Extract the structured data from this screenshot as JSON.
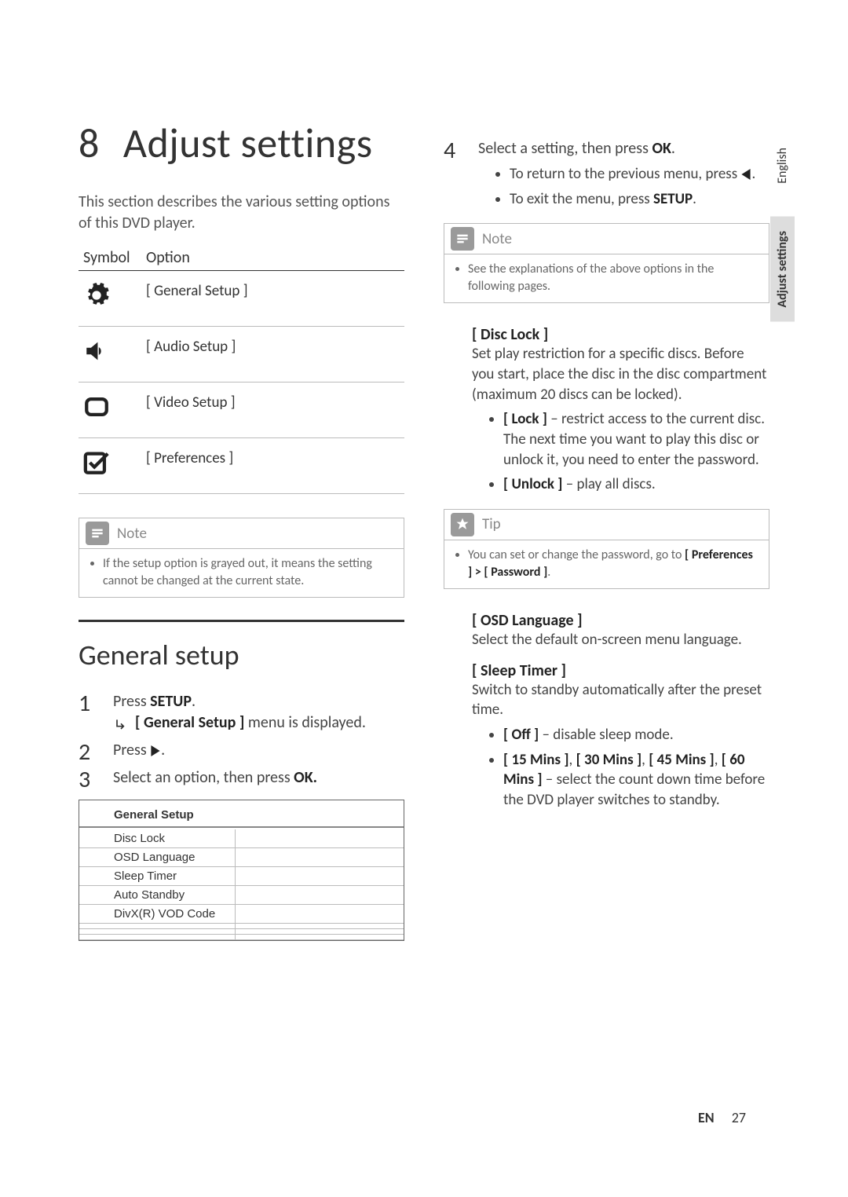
{
  "chapter": {
    "number": "8",
    "title": "Adjust settings"
  },
  "intro": "This section describes the various setting options of this DVD player.",
  "sym_table": {
    "head_sym": "Symbol",
    "head_opt": "Option",
    "rows": [
      {
        "icon": "gear-icon",
        "label": "[ General Setup ]"
      },
      {
        "icon": "speaker-icon",
        "label": "[ Audio Setup ]"
      },
      {
        "icon": "screen-icon",
        "label": "[ Video Setup ]"
      },
      {
        "icon": "check-icon",
        "label": "[ Preferences ]"
      }
    ]
  },
  "note1": {
    "title": "Note",
    "text": "If the setup option is grayed out, it means the setting cannot be changed at the current state."
  },
  "section": "General setup",
  "steps_left": {
    "s1_a": "Press ",
    "s1_b": "SETUP",
    "s1_c": ".",
    "s1_sub_a": "[ General Setup ]",
    "s1_sub_b": " menu is displayed.",
    "s2_a": "Press ",
    "s2_b": ".",
    "s3_a": "Select an option, then press ",
    "s3_b": "OK."
  },
  "menu": {
    "title": "General Setup",
    "items": [
      "Disc Lock",
      "OSD Language",
      "Sleep Timer",
      "Auto Standby",
      "DivX(R) VOD Code",
      "",
      "",
      ""
    ]
  },
  "steps_right": {
    "s4_a": "Select a setting, then press ",
    "s4_b": "OK",
    "s4_c": ".",
    "b1_a": "To return to the previous menu, press ",
    "b1_b": ".",
    "b2_a": "To exit the menu, press ",
    "b2_b": "SETUP",
    "b2_c": "."
  },
  "note2": {
    "title": "Note",
    "text": "See the explanations of the above options in the following pages."
  },
  "disc_lock": {
    "title": "[ Disc Lock ]",
    "desc": "Set play restriction for a specific discs. Before you start, place the disc in the disc compartment (maximum 20 discs can be locked).",
    "lock_a": "[ Lock ]",
    "lock_b": " – restrict access to the current disc. The next time you want to play this disc or unlock it, you need to enter the password.",
    "unlock_a": "[ Unlock ]",
    "unlock_b": " – play all discs."
  },
  "tip": {
    "title": "Tip",
    "text_a": "You can set or change the password, go to ",
    "text_b": "[ Preferences ] > [ Password ]",
    "text_c": "."
  },
  "osd_lang": {
    "title": "[ OSD Language ]",
    "desc": "Select the default on-screen menu language."
  },
  "sleep": {
    "title": "[ Sleep Timer ]",
    "desc": "Switch to standby automatically after the preset time.",
    "off_a": "[ Off ]",
    "off_b": " – disable sleep mode.",
    "mins_a": "[ 15 Mins ]",
    "mins_b": ", ",
    "mins_c": "[ 30 Mins ]",
    "mins_d": ", ",
    "mins_e": "[ 45 Mins ]",
    "mins_f": ", ",
    "mins_g": "[ 60 Mins ]",
    "mins_h": " – select the count down time before the DVD player switches to standby."
  },
  "sidetabs": {
    "lang": "English",
    "active": "Adjust settings"
  },
  "footer": {
    "en": "EN",
    "page": "27"
  }
}
